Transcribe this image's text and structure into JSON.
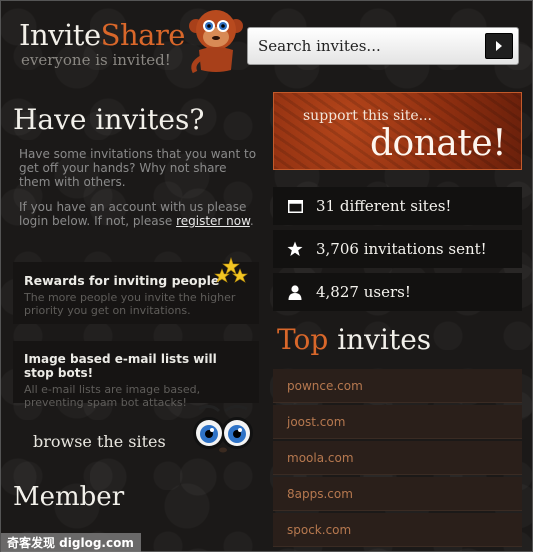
{
  "header": {
    "logo_part1": "Invite",
    "logo_part2": "Share",
    "tagline": "everyone is invited!",
    "search_placeholder": "Search invites..."
  },
  "left": {
    "heading": "Have invites?",
    "intro": "Have some invitations that you want to get off your hands? Why not share them with others.",
    "intro2_prefix": "If you have an account with us please login below. If not, please ",
    "register_link": "register now",
    "intro2_suffix": ".",
    "features": [
      {
        "title": "Rewards for inviting people",
        "text": "The more people you invite the higher priority you get on invitations."
      },
      {
        "title": "Image based e-mail lists will stop bots!",
        "text": "All e-mail lists are image based, preventing spam bot attacks!"
      }
    ],
    "browse_label": "browse the sites",
    "member_heading": "Member"
  },
  "right": {
    "donate_small": "support this site...",
    "donate_big": "donate!",
    "stats": [
      {
        "icon": "browser-window-icon",
        "text": "31 different sites!"
      },
      {
        "icon": "star-icon",
        "text": "3,706 invitations sent!"
      },
      {
        "icon": "user-icon",
        "text": "4,827 users!"
      }
    ],
    "top_heading_part1": "Top",
    "top_heading_part2": " invites",
    "sites": [
      "pownce.com",
      "joost.com",
      "moola.com",
      "8apps.com",
      "spock.com"
    ]
  },
  "watermark": "奇客发现 diglog.com",
  "colors": {
    "accent": "#d9672a",
    "background": "#1b1918",
    "donate_bg": "#8f2f10",
    "site_item_bg": "#2a1f1a",
    "site_link": "#b6784f"
  }
}
